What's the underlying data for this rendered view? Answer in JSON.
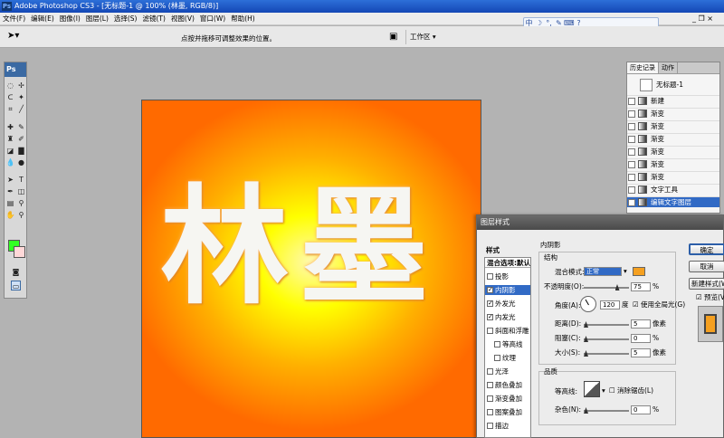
{
  "app": {
    "title": "Adobe Photoshop CS3 - [无标题-1 @ 100% (林墨, RGB/8)]",
    "logo": "Ps"
  },
  "menu": [
    "文件(F)",
    "编辑(E)",
    "图像(I)",
    "图层(L)",
    "选择(S)",
    "滤镜(T)",
    "视图(V)",
    "窗口(W)",
    "帮助(H)"
  ],
  "ime": {
    "items": [
      "中",
      "☽",
      "°,",
      "✎",
      "⌨",
      "?"
    ]
  },
  "window_controls": [
    "_",
    "❐",
    "×"
  ],
  "options_bar": {
    "hint": "点按并拖移可调整效果的位置。",
    "workspace_label": "工作区 ▾"
  },
  "toolbox": {
    "logo": "Ps",
    "fg_color": "#33ff22",
    "bg_color": "#ffd8d8"
  },
  "canvas": {
    "text": "林墨"
  },
  "history": {
    "tabs": [
      "历史记录",
      "动作"
    ],
    "snapshot": "无标题-1",
    "items": [
      "新建",
      "渐变",
      "渐变",
      "渐变",
      "渐变",
      "渐变",
      "渐变",
      "文字工具",
      "编辑文字图层"
    ],
    "selected_index": 8
  },
  "dialog": {
    "title": "图层样式",
    "styles_header": "样式",
    "styles": [
      {
        "label": "混合选项:默认",
        "checked": false,
        "type": "head"
      },
      {
        "label": "投影",
        "checked": false
      },
      {
        "label": "内阴影",
        "checked": true,
        "selected": true
      },
      {
        "label": "外发光",
        "checked": true
      },
      {
        "label": "内发光",
        "checked": true
      },
      {
        "label": "斜面和浮雕",
        "checked": false
      },
      {
        "label": "等高线",
        "checked": false,
        "sub": true
      },
      {
        "label": "纹理",
        "checked": false,
        "sub": true
      },
      {
        "label": "光泽",
        "checked": false
      },
      {
        "label": "颜色叠加",
        "checked": false
      },
      {
        "label": "渐变叠加",
        "checked": false
      },
      {
        "label": "图案叠加",
        "checked": false
      },
      {
        "label": "描边",
        "checked": false
      }
    ],
    "section_title": "内阴影",
    "structure": "结构",
    "blend_mode_label": "混合模式:",
    "blend_mode_value": "正常",
    "swatch_color": "#f5a020",
    "opacity_label": "不透明度(O):",
    "opacity_value": "75",
    "angle_label": "角度(A):",
    "angle_value": "120",
    "angle_unit": "度",
    "global_light_label": "使用全局光(G)",
    "distance_label": "距离(D):",
    "distance_value": "5",
    "choke_label": "阻塞(C):",
    "choke_value": "0",
    "size_label": "大小(S):",
    "size_value": "5",
    "px_unit": "像素",
    "pct_unit": "%",
    "quality": "品质",
    "contour_label": "等高线:",
    "antialias_label": "消除锯齿(L)",
    "noise_label": "杂色(N):",
    "noise_value": "0",
    "buttons": {
      "ok": "确定",
      "cancel": "取消",
      "new_style": "新建样式(W)...",
      "preview": "预览(V)"
    }
  }
}
